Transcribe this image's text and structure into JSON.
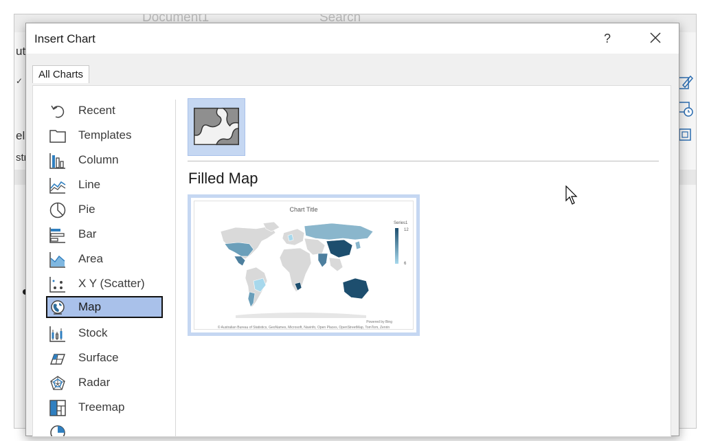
{
  "background": {
    "topbar_left": "Document1",
    "topbar_right": "Search",
    "left_fragments": [
      "ut",
      "els",
      "str"
    ]
  },
  "dialog": {
    "title": "Insert Chart",
    "help_label": "?",
    "tab_label": "All Charts"
  },
  "sidebar": {
    "items": [
      {
        "label": "Recent",
        "icon": "recent-icon"
      },
      {
        "label": "Templates",
        "icon": "folder-icon"
      },
      {
        "label": "Column",
        "icon": "column-chart-icon"
      },
      {
        "label": "Line",
        "icon": "line-chart-icon"
      },
      {
        "label": "Pie",
        "icon": "pie-chart-icon"
      },
      {
        "label": "Bar",
        "icon": "bar-chart-icon"
      },
      {
        "label": "Area",
        "icon": "area-chart-icon"
      },
      {
        "label": "X Y (Scatter)",
        "icon": "scatter-chart-icon"
      },
      {
        "label": "Map",
        "icon": "map-chart-icon",
        "selected": true
      },
      {
        "label": "Stock",
        "icon": "stock-chart-icon"
      },
      {
        "label": "Surface",
        "icon": "surface-chart-icon"
      },
      {
        "label": "Radar",
        "icon": "radar-chart-icon"
      },
      {
        "label": "Treemap",
        "icon": "treemap-chart-icon"
      }
    ]
  },
  "main": {
    "chart_type_heading": "Filled Map",
    "preview": {
      "title": "Chart Title",
      "legend_title": "Series1",
      "legend_max": "12",
      "legend_min": "6",
      "powered_by": "Powered by Bing",
      "attribution": "© Australian Bureau of Statistics, GeoNames, Microsoft, Navinfo, Open Places, OpenStreetMap, TomTom, Zenrin"
    }
  },
  "colors": {
    "selected_bg": "#a9c1ea",
    "thumb_bg": "#c5d7f2",
    "map_dark": "#1d4e6e",
    "map_light": "#a7d8ec",
    "map_land": "#d9d9d9"
  }
}
